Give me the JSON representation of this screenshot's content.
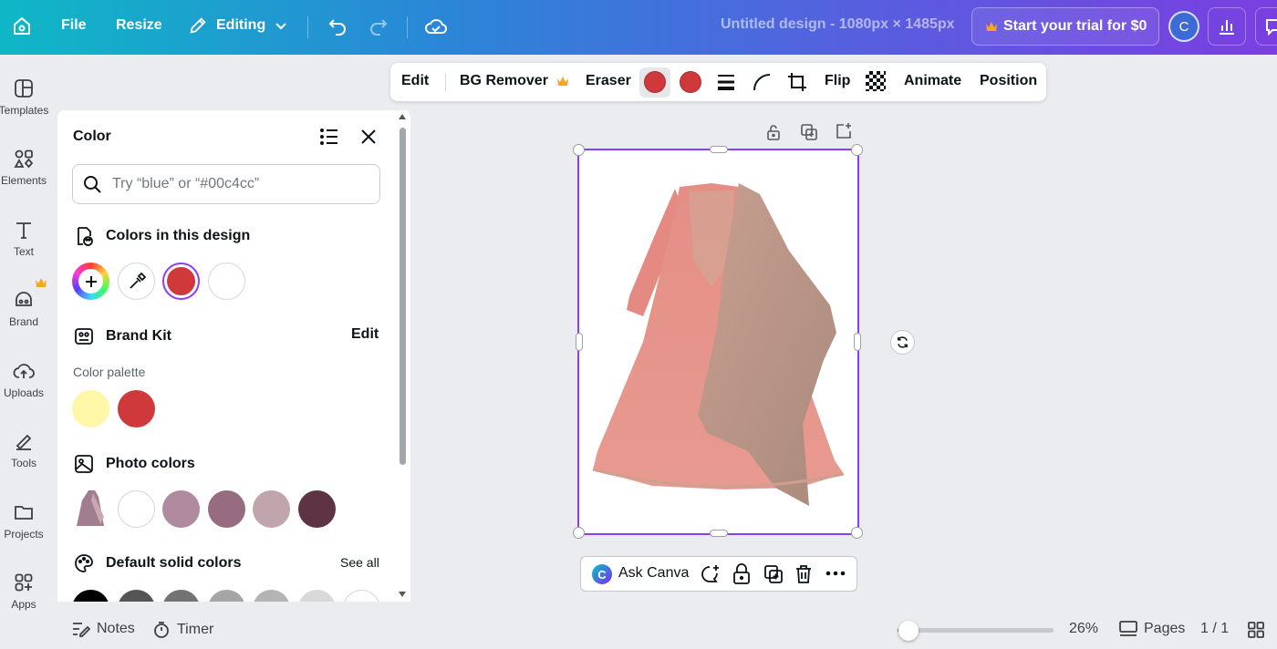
{
  "topbar": {
    "file": "File",
    "resize": "Resize",
    "editing": "Editing",
    "title": "Untitled design - 1080px × 1485px",
    "trial": "Start your trial for $0",
    "avatar": "C"
  },
  "rail": {
    "items": [
      {
        "label": "Templates",
        "icon": "templates-icon"
      },
      {
        "label": "Elements",
        "icon": "elements-icon"
      },
      {
        "label": "Text",
        "icon": "text-icon"
      },
      {
        "label": "Brand",
        "icon": "brand-icon"
      },
      {
        "label": "Uploads",
        "icon": "uploads-icon"
      },
      {
        "label": "Tools",
        "icon": "tools-icon"
      },
      {
        "label": "Projects",
        "icon": "projects-icon"
      },
      {
        "label": "Apps",
        "icon": "apps-icon"
      }
    ]
  },
  "color_panel": {
    "title": "Color",
    "search_placeholder": "Try “blue” or “#00c4cc”",
    "in_design_title": "Colors in this design",
    "in_design_colors": [
      "#d0393b",
      "#ffffff"
    ],
    "brand_kit_title": "Brand Kit",
    "brand_kit_edit": "Edit",
    "palette_label": "Color palette",
    "palette_colors": [
      "#fef7a8",
      "#d0393b"
    ],
    "photo_colors_title": "Photo colors",
    "photo_colors": [
      "#ffffff",
      "#b08a9f",
      "#986c80",
      "#c1a5ac",
      "#5e3444"
    ],
    "default_title": "Default solid colors",
    "see_all": "See all",
    "default_colors": [
      "#000000",
      "#545454",
      "#737373",
      "#a6a6a6",
      "#b4b4b4",
      "#d9d9d9",
      "#ffffff"
    ]
  },
  "context_toolbar": {
    "edit": "Edit",
    "bg_remover": "BG Remover",
    "eraser": "Eraser",
    "color1": "#d0393b",
    "color2": "#d0393b",
    "flip": "Flip",
    "animate": "Animate",
    "position": "Position"
  },
  "canvas": {
    "ask_canva": "Ask Canva"
  },
  "bottom": {
    "notes": "Notes",
    "timer": "Timer",
    "zoom_percent": 26,
    "zoom": "26%",
    "pages": "Pages",
    "page_count": "1 / 1"
  },
  "colors": {
    "accent": "#8b3dff",
    "crown": "#f5a623"
  }
}
